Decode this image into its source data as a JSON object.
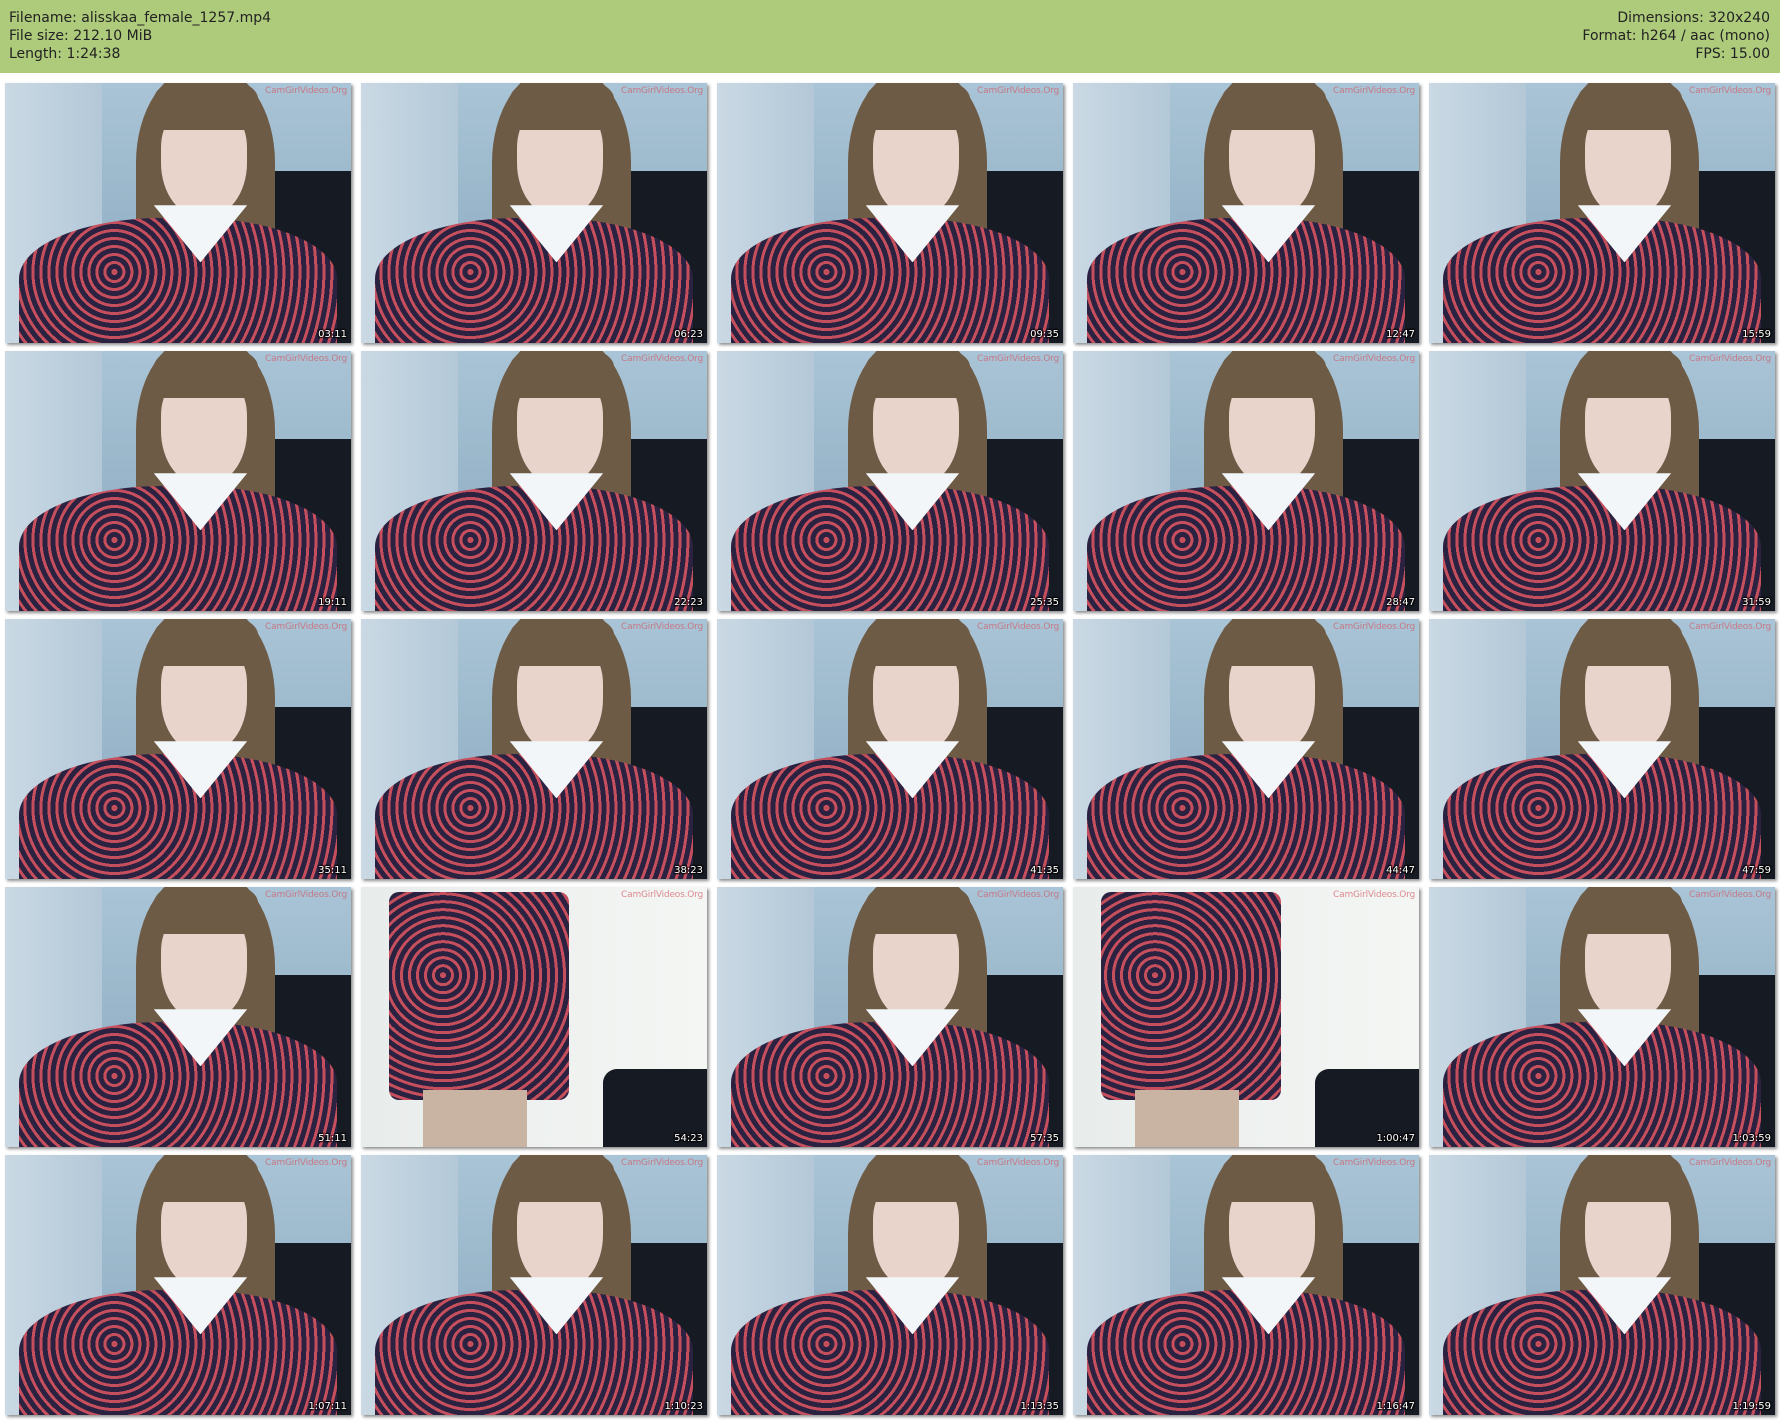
{
  "header": {
    "filename": "Filename: alisskaa_female_1257.mp4",
    "filesize": "File size: 212.10 MiB",
    "length": "Length: 1:24:38",
    "dimensions": "Dimensions: 320x240",
    "format": "Format: h264 / aac (mono)",
    "fps": "FPS: 15.00"
  },
  "watermark": "CamGirlVideos.Org",
  "thumbnails": [
    {
      "time": "03:11",
      "scene": "seated"
    },
    {
      "time": "06:23",
      "scene": "seated"
    },
    {
      "time": "09:35",
      "scene": "seated"
    },
    {
      "time": "12:47",
      "scene": "seated"
    },
    {
      "time": "15:59",
      "scene": "seated"
    },
    {
      "time": "19:11",
      "scene": "seated"
    },
    {
      "time": "22:23",
      "scene": "seated"
    },
    {
      "time": "25:35",
      "scene": "seated"
    },
    {
      "time": "28:47",
      "scene": "seated"
    },
    {
      "time": "31:59",
      "scene": "seated"
    },
    {
      "time": "35:11",
      "scene": "seated"
    },
    {
      "time": "38:23",
      "scene": "seated"
    },
    {
      "time": "41:35",
      "scene": "seated"
    },
    {
      "time": "44:47",
      "scene": "seated"
    },
    {
      "time": "47:59",
      "scene": "seated"
    },
    {
      "time": "51:11",
      "scene": "seated"
    },
    {
      "time": "54:23",
      "scene": "standing"
    },
    {
      "time": "57:35",
      "scene": "seated"
    },
    {
      "time": "1:00:47",
      "scene": "standing"
    },
    {
      "time": "1:03:59",
      "scene": "seated"
    },
    {
      "time": "1:07:11",
      "scene": "seated"
    },
    {
      "time": "1:10:23",
      "scene": "seated"
    },
    {
      "time": "1:13:35",
      "scene": "seated"
    },
    {
      "time": "1:16:47",
      "scene": "seated"
    },
    {
      "time": "1:19:59",
      "scene": "seated"
    }
  ],
  "colors": {
    "header_bg": "#aecb7c",
    "dress": "#c54f5c",
    "background": "#ffffff"
  }
}
